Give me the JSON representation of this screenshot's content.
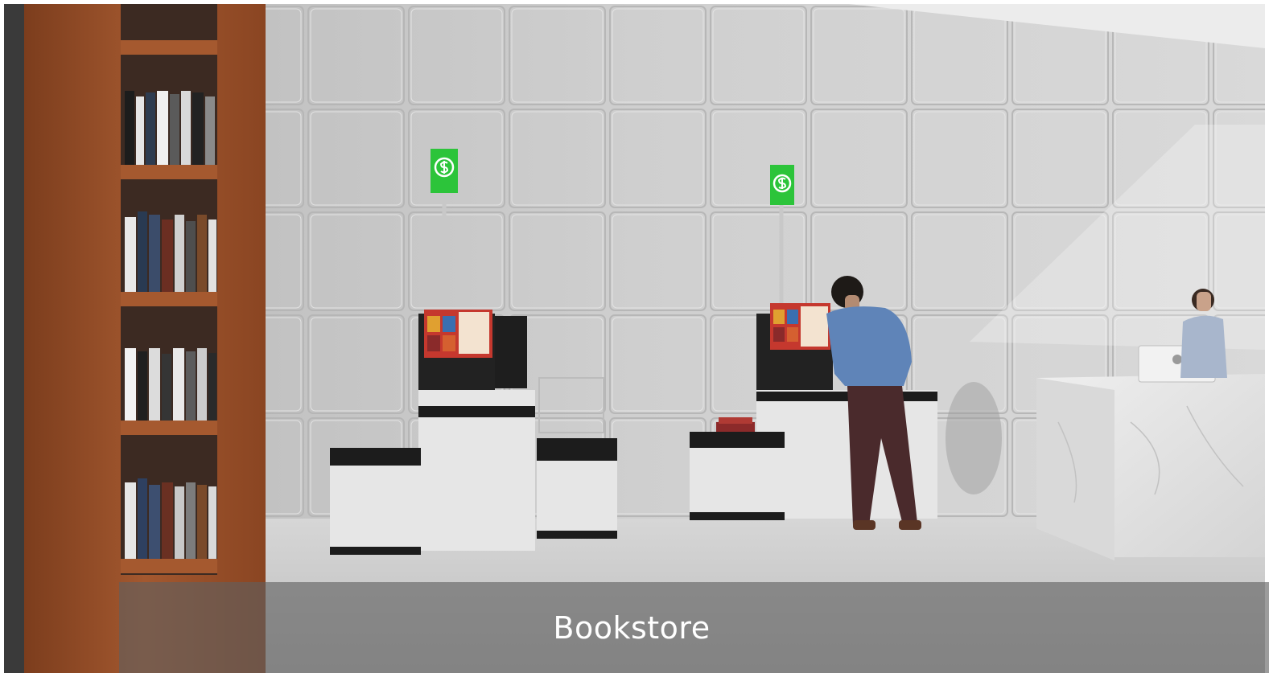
{
  "caption": "Bookstore",
  "colors": {
    "wall": "#d2d2d2",
    "shelf_wood": "#9a4f28",
    "kiosk_body": "#e6e6e6",
    "kiosk_sign": "#2cc43a",
    "floor": "#c9c9c9",
    "counter_marble": "#e4e4e4",
    "caption_band": "#5f5f5f"
  },
  "icons": {
    "kiosk_sign": "dollar-sign-icon"
  }
}
